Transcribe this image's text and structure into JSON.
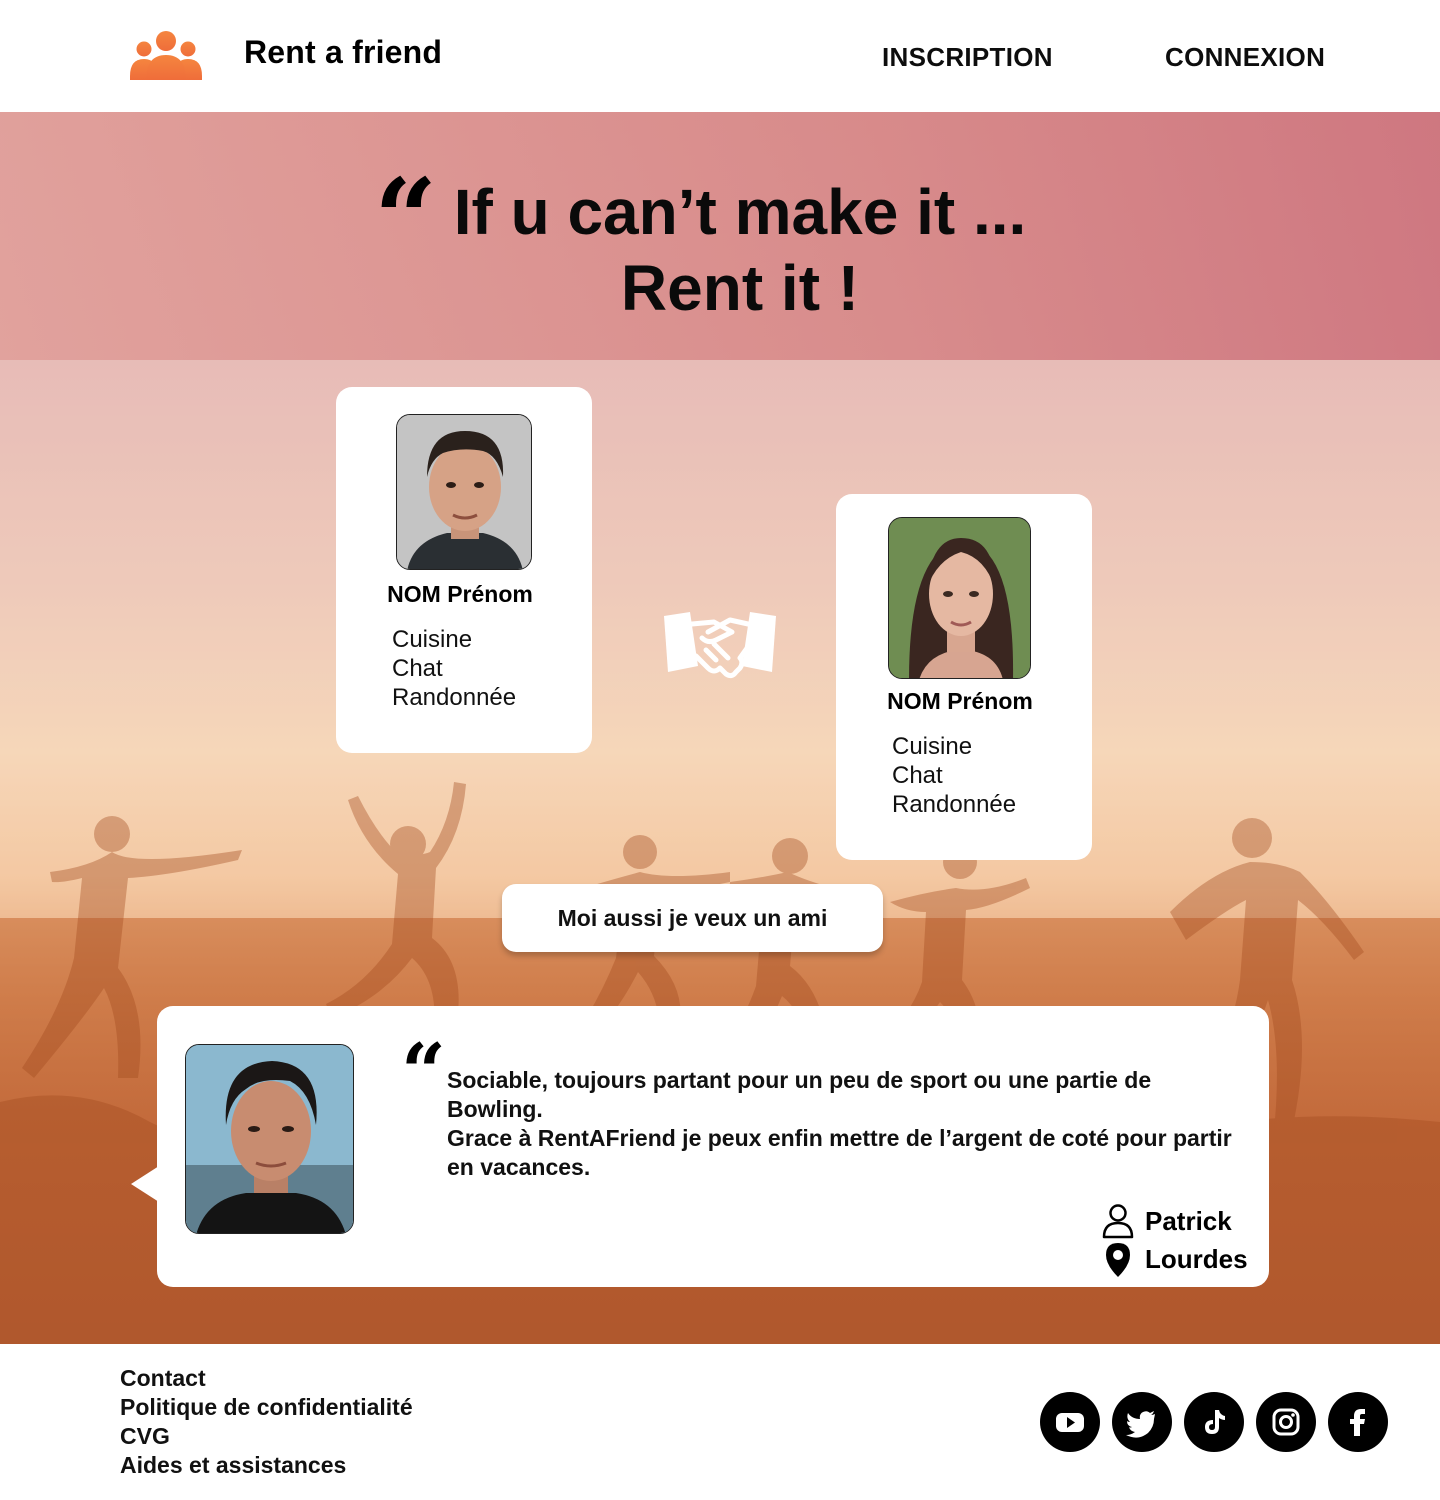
{
  "header": {
    "brand": "Rent a friend",
    "nav": {
      "inscription": "INSCRIPTION",
      "connexion": "CONNEXION"
    }
  },
  "hero": {
    "quote_mark": "“",
    "title_line1": "If u can’t make it ...",
    "title_line2": "Rent it !"
  },
  "profiles": [
    {
      "name": "NOM Prénom",
      "interests": [
        "Cuisine",
        "Chat",
        "Randonnée"
      ]
    },
    {
      "name": "NOM Prénom",
      "interests": [
        "Cuisine",
        "Chat",
        "Randonnée"
      ]
    }
  ],
  "cta": {
    "label": "Moi aussi je veux un ami"
  },
  "testimonial": {
    "quote_mark": "“",
    "line1": "Sociable, toujours partant pour un peu de sport ou une partie de Bowling.",
    "line2": "Grace à RentAFriend je peux enfin mettre de l’argent de coté pour partir en vacances.",
    "author": "Patrick",
    "location": "Lourdes"
  },
  "footer": {
    "links": [
      "Contact",
      "Politique de confidentialité",
      "CVG",
      "Aides et assistances"
    ],
    "socials": [
      "youtube-icon",
      "twitter-icon",
      "tiktok-icon",
      "instagram-icon",
      "facebook-icon"
    ]
  },
  "colors": {
    "accent": "#f07a3a",
    "black": "#000000",
    "white": "#ffffff"
  }
}
